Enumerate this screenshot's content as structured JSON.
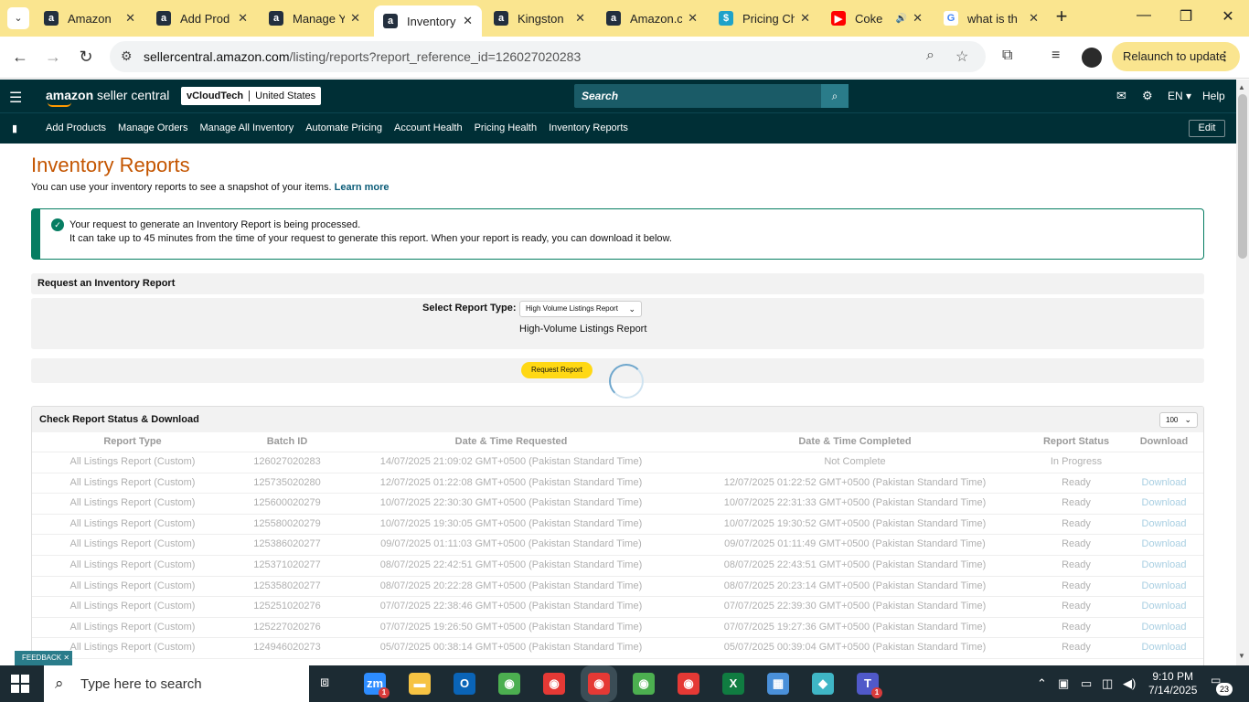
{
  "browser": {
    "tabs": [
      {
        "title": "Amazon",
        "icon": "amazon-icon",
        "color": "#232f3e",
        "glyph": "a"
      },
      {
        "title": "Add Prod",
        "icon": "amazon-icon",
        "color": "#232f3e",
        "glyph": "a"
      },
      {
        "title": "Manage Y",
        "icon": "amazon-icon",
        "color": "#232f3e",
        "glyph": "a"
      },
      {
        "title": "Inventory",
        "icon": "amazon-icon",
        "color": "#232f3e",
        "glyph": "a"
      },
      {
        "title": "Kingston",
        "icon": "amazon-icon",
        "color": "#232f3e",
        "glyph": "a"
      },
      {
        "title": "Amazon.c",
        "icon": "amazon-icon",
        "color": "#232f3e",
        "glyph": "a"
      },
      {
        "title": "Pricing Ch",
        "icon": "dollar-icon",
        "color": "#1fa2c9",
        "glyph": "$"
      },
      {
        "title": "Coke",
        "icon": "youtube-icon",
        "color": "#ff0000",
        "glyph": "▶"
      },
      {
        "title": "what is th",
        "icon": "google-icon",
        "color": "#ffffff",
        "glyph": "G"
      }
    ],
    "active_tab_index": 3,
    "url_host": "sellercentral.amazon.com",
    "url_path": "/listing/reports?report_reference_id=126027020283",
    "relaunch_label": "Relaunch to update"
  },
  "seller": {
    "logo_brand": "amazon",
    "logo_suffix": " seller central",
    "account": "vCloudTech",
    "marketplace": "United States",
    "search_placeholder": "Search",
    "language": "EN",
    "help": "Help",
    "nav": [
      "Add Products",
      "Manage Orders",
      "Manage All Inventory",
      "Automate Pricing",
      "Account Health",
      "Pricing Health",
      "Inventory Reports"
    ],
    "edit_label": "Edit"
  },
  "page": {
    "title": "Inventory Reports",
    "subtitle": "You can use your inventory reports to see a snapshot of your items.",
    "learn_more": "Learn more",
    "alert_line1": "Your request to generate an Inventory Report is being processed.",
    "alert_line2": "It can take up to 45 minutes from the time of your request to generate this report. When your report is ready, you can download it below.",
    "request_section_title": "Request an Inventory Report",
    "select_label": "Select Report Type:",
    "selected_type": "High Volume Listings Report",
    "selected_type_name": "High-Volume Listings Report",
    "request_button": "Request Report",
    "status_section_title": "Check Report Status & Download",
    "page_size": "100",
    "feedback": "FEEDBACK"
  },
  "table": {
    "headers": [
      "Report Type",
      "Batch ID",
      "Date & Time Requested",
      "Date & Time Completed",
      "Report Status",
      "Download"
    ],
    "rows": [
      [
        "All Listings Report (Custom)",
        "126027020283",
        "14/07/2025 21:09:02 GMT+0500 (Pakistan Standard Time)",
        "Not Complete",
        "In Progress",
        ""
      ],
      [
        "All Listings Report (Custom)",
        "125735020280",
        "12/07/2025 01:22:08 GMT+0500 (Pakistan Standard Time)",
        "12/07/2025 01:22:52 GMT+0500 (Pakistan Standard Time)",
        "Ready",
        "Download"
      ],
      [
        "All Listings Report (Custom)",
        "125600020279",
        "10/07/2025 22:30:30 GMT+0500 (Pakistan Standard Time)",
        "10/07/2025 22:31:33 GMT+0500 (Pakistan Standard Time)",
        "Ready",
        "Download"
      ],
      [
        "All Listings Report (Custom)",
        "125580020279",
        "10/07/2025 19:30:05 GMT+0500 (Pakistan Standard Time)",
        "10/07/2025 19:30:52 GMT+0500 (Pakistan Standard Time)",
        "Ready",
        "Download"
      ],
      [
        "All Listings Report (Custom)",
        "125386020277",
        "09/07/2025 01:11:03 GMT+0500 (Pakistan Standard Time)",
        "09/07/2025 01:11:49 GMT+0500 (Pakistan Standard Time)",
        "Ready",
        "Download"
      ],
      [
        "All Listings Report (Custom)",
        "125371020277",
        "08/07/2025 22:42:51 GMT+0500 (Pakistan Standard Time)",
        "08/07/2025 22:43:51 GMT+0500 (Pakistan Standard Time)",
        "Ready",
        "Download"
      ],
      [
        "All Listings Report (Custom)",
        "125358020277",
        "08/07/2025 20:22:28 GMT+0500 (Pakistan Standard Time)",
        "08/07/2025 20:23:14 GMT+0500 (Pakistan Standard Time)",
        "Ready",
        "Download"
      ],
      [
        "All Listings Report (Custom)",
        "125251020276",
        "07/07/2025 22:38:46 GMT+0500 (Pakistan Standard Time)",
        "07/07/2025 22:39:30 GMT+0500 (Pakistan Standard Time)",
        "Ready",
        "Download"
      ],
      [
        "All Listings Report (Custom)",
        "125227020276",
        "07/07/2025 19:26:50 GMT+0500 (Pakistan Standard Time)",
        "07/07/2025 19:27:36 GMT+0500 (Pakistan Standard Time)",
        "Ready",
        "Download"
      ],
      [
        "All Listings Report (Custom)",
        "124946020273",
        "05/07/2025 00:38:14 GMT+0500 (Pakistan Standard Time)",
        "05/07/2025 00:39:04 GMT+0500 (Pakistan Standard Time)",
        "Ready",
        "Download"
      ]
    ]
  },
  "taskbar": {
    "search_placeholder": "Type here to search",
    "time": "9:10 PM",
    "date": "7/14/2025",
    "notifications": "23",
    "apps": [
      {
        "name": "zoom-app",
        "color": "#2d8cff",
        "glyph": "zm",
        "badge": "1"
      },
      {
        "name": "file-explorer-app",
        "color": "#f6c343",
        "glyph": "▬",
        "badge": ""
      },
      {
        "name": "outlook-app",
        "color": "#0a64b7",
        "glyph": "O",
        "badge": ""
      },
      {
        "name": "chrome-app",
        "color": "#4caf50",
        "glyph": "◉",
        "badge": ""
      },
      {
        "name": "chrome-app-2",
        "color": "#e53935",
        "glyph": "◉",
        "badge": ""
      },
      {
        "name": "chrome-app-active",
        "color": "#e53935",
        "glyph": "◉",
        "badge": ""
      },
      {
        "name": "chrome-app-3",
        "color": "#4caf50",
        "glyph": "◉",
        "badge": ""
      },
      {
        "name": "chrome-app-4",
        "color": "#e53935",
        "glyph": "◉",
        "badge": ""
      },
      {
        "name": "excel-app",
        "color": "#107c41",
        "glyph": "X",
        "badge": ""
      },
      {
        "name": "calculator-app",
        "color": "#4a90d9",
        "glyph": "▦",
        "badge": ""
      },
      {
        "name": "vscode-like-app",
        "color": "#3fb6c6",
        "glyph": "◆",
        "badge": ""
      },
      {
        "name": "teams-app",
        "color": "#5059c9",
        "glyph": "T",
        "badge": "1"
      }
    ]
  }
}
